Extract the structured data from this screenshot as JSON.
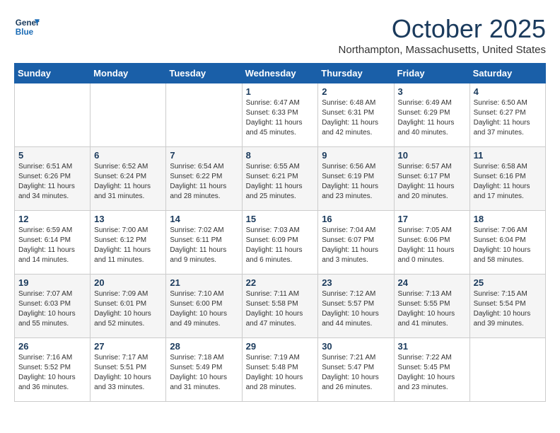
{
  "header": {
    "logo_line1": "General",
    "logo_line2": "Blue",
    "month": "October 2025",
    "location": "Northampton, Massachusetts, United States"
  },
  "weekdays": [
    "Sunday",
    "Monday",
    "Tuesday",
    "Wednesday",
    "Thursday",
    "Friday",
    "Saturday"
  ],
  "weeks": [
    [
      {
        "day": "",
        "info": ""
      },
      {
        "day": "",
        "info": ""
      },
      {
        "day": "",
        "info": ""
      },
      {
        "day": "1",
        "info": "Sunrise: 6:47 AM\nSunset: 6:33 PM\nDaylight: 11 hours and 45 minutes."
      },
      {
        "day": "2",
        "info": "Sunrise: 6:48 AM\nSunset: 6:31 PM\nDaylight: 11 hours and 42 minutes."
      },
      {
        "day": "3",
        "info": "Sunrise: 6:49 AM\nSunset: 6:29 PM\nDaylight: 11 hours and 40 minutes."
      },
      {
        "day": "4",
        "info": "Sunrise: 6:50 AM\nSunset: 6:27 PM\nDaylight: 11 hours and 37 minutes."
      }
    ],
    [
      {
        "day": "5",
        "info": "Sunrise: 6:51 AM\nSunset: 6:26 PM\nDaylight: 11 hours and 34 minutes."
      },
      {
        "day": "6",
        "info": "Sunrise: 6:52 AM\nSunset: 6:24 PM\nDaylight: 11 hours and 31 minutes."
      },
      {
        "day": "7",
        "info": "Sunrise: 6:54 AM\nSunset: 6:22 PM\nDaylight: 11 hours and 28 minutes."
      },
      {
        "day": "8",
        "info": "Sunrise: 6:55 AM\nSunset: 6:21 PM\nDaylight: 11 hours and 25 minutes."
      },
      {
        "day": "9",
        "info": "Sunrise: 6:56 AM\nSunset: 6:19 PM\nDaylight: 11 hours and 23 minutes."
      },
      {
        "day": "10",
        "info": "Sunrise: 6:57 AM\nSunset: 6:17 PM\nDaylight: 11 hours and 20 minutes."
      },
      {
        "day": "11",
        "info": "Sunrise: 6:58 AM\nSunset: 6:16 PM\nDaylight: 11 hours and 17 minutes."
      }
    ],
    [
      {
        "day": "12",
        "info": "Sunrise: 6:59 AM\nSunset: 6:14 PM\nDaylight: 11 hours and 14 minutes."
      },
      {
        "day": "13",
        "info": "Sunrise: 7:00 AM\nSunset: 6:12 PM\nDaylight: 11 hours and 11 minutes."
      },
      {
        "day": "14",
        "info": "Sunrise: 7:02 AM\nSunset: 6:11 PM\nDaylight: 11 hours and 9 minutes."
      },
      {
        "day": "15",
        "info": "Sunrise: 7:03 AM\nSunset: 6:09 PM\nDaylight: 11 hours and 6 minutes."
      },
      {
        "day": "16",
        "info": "Sunrise: 7:04 AM\nSunset: 6:07 PM\nDaylight: 11 hours and 3 minutes."
      },
      {
        "day": "17",
        "info": "Sunrise: 7:05 AM\nSunset: 6:06 PM\nDaylight: 11 hours and 0 minutes."
      },
      {
        "day": "18",
        "info": "Sunrise: 7:06 AM\nSunset: 6:04 PM\nDaylight: 10 hours and 58 minutes."
      }
    ],
    [
      {
        "day": "19",
        "info": "Sunrise: 7:07 AM\nSunset: 6:03 PM\nDaylight: 10 hours and 55 minutes."
      },
      {
        "day": "20",
        "info": "Sunrise: 7:09 AM\nSunset: 6:01 PM\nDaylight: 10 hours and 52 minutes."
      },
      {
        "day": "21",
        "info": "Sunrise: 7:10 AM\nSunset: 6:00 PM\nDaylight: 10 hours and 49 minutes."
      },
      {
        "day": "22",
        "info": "Sunrise: 7:11 AM\nSunset: 5:58 PM\nDaylight: 10 hours and 47 minutes."
      },
      {
        "day": "23",
        "info": "Sunrise: 7:12 AM\nSunset: 5:57 PM\nDaylight: 10 hours and 44 minutes."
      },
      {
        "day": "24",
        "info": "Sunrise: 7:13 AM\nSunset: 5:55 PM\nDaylight: 10 hours and 41 minutes."
      },
      {
        "day": "25",
        "info": "Sunrise: 7:15 AM\nSunset: 5:54 PM\nDaylight: 10 hours and 39 minutes."
      }
    ],
    [
      {
        "day": "26",
        "info": "Sunrise: 7:16 AM\nSunset: 5:52 PM\nDaylight: 10 hours and 36 minutes."
      },
      {
        "day": "27",
        "info": "Sunrise: 7:17 AM\nSunset: 5:51 PM\nDaylight: 10 hours and 33 minutes."
      },
      {
        "day": "28",
        "info": "Sunrise: 7:18 AM\nSunset: 5:49 PM\nDaylight: 10 hours and 31 minutes."
      },
      {
        "day": "29",
        "info": "Sunrise: 7:19 AM\nSunset: 5:48 PM\nDaylight: 10 hours and 28 minutes."
      },
      {
        "day": "30",
        "info": "Sunrise: 7:21 AM\nSunset: 5:47 PM\nDaylight: 10 hours and 26 minutes."
      },
      {
        "day": "31",
        "info": "Sunrise: 7:22 AM\nSunset: 5:45 PM\nDaylight: 10 hours and 23 minutes."
      },
      {
        "day": "",
        "info": ""
      }
    ]
  ]
}
